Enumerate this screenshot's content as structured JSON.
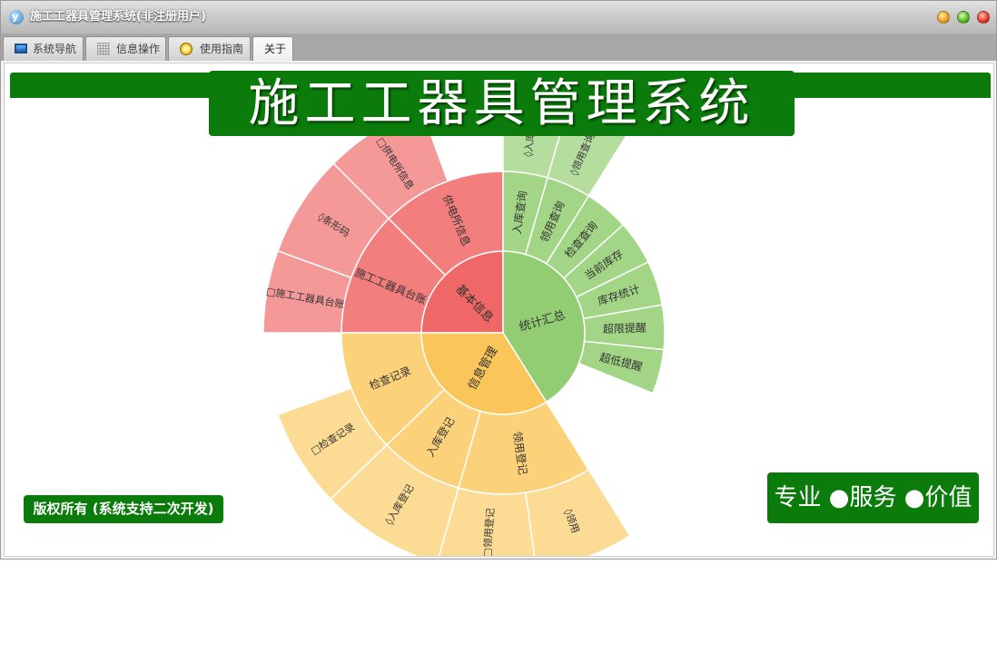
{
  "window": {
    "title": "施工工器具管理系统(非注册用户)",
    "app_icon_letter": "y"
  },
  "tabs": [
    {
      "label": "系统导航",
      "icon": "monitor-icon"
    },
    {
      "label": "信息操作",
      "icon": "grid-icon"
    },
    {
      "label": "使用指南",
      "icon": "clock-icon"
    },
    {
      "label": "关于",
      "icon": ""
    }
  ],
  "active_tab": "关于",
  "banner": {
    "title": "施工工器具管理系统"
  },
  "copyright": "版权所有 (系统支持二次开发)",
  "slogan": "专业 ●服务 ●价值",
  "colors": {
    "brand_green": "#0b7b0b",
    "red_l1": "#f06767",
    "red_l2": "#f27e7e",
    "red_l3": "#f49898",
    "yellow_l1": "#fac65a",
    "yellow_l2": "#fbd27a",
    "yellow_l3": "#fcdc95",
    "green_l1": "#92cd74",
    "green_l2": "#a2d585",
    "green_l3": "#b5dd9e"
  },
  "sunburst": [
    {
      "name": "基本信息",
      "color": "red",
      "children": [
        {
          "name": "施工工器具台账",
          "children": [
            {
              "name": "□施工工器具台账"
            },
            {
              "name": "◊条形码"
            }
          ]
        },
        {
          "name": "供电所信息",
          "children": [
            {
              "name": "□供电所信息"
            }
          ]
        }
      ]
    },
    {
      "name": "统计汇总",
      "color": "green",
      "children": [
        {
          "name": "入库查询",
          "children": [
            {
              "name": "◊入库查询"
            }
          ]
        },
        {
          "name": "领用查询",
          "children": [
            {
              "name": "◊领用查询表"
            }
          ]
        },
        {
          "name": "检查查询",
          "children": []
        },
        {
          "name": "当前库存",
          "children": []
        },
        {
          "name": "库存统计",
          "children": []
        },
        {
          "name": "超限提醒",
          "children": []
        },
        {
          "name": "超低提醒",
          "children": []
        }
      ]
    },
    {
      "name": "信息管理",
      "color": "yellow",
      "children": [
        {
          "name": "领用登记",
          "children": [
            {
              "name": "◊领用"
            },
            {
              "name": "□领用登记"
            }
          ]
        },
        {
          "name": "入库登记",
          "children": [
            {
              "name": "◊入库登记"
            }
          ]
        },
        {
          "name": "检查记录",
          "children": [
            {
              "name": "□检查记录"
            }
          ]
        }
      ]
    }
  ]
}
